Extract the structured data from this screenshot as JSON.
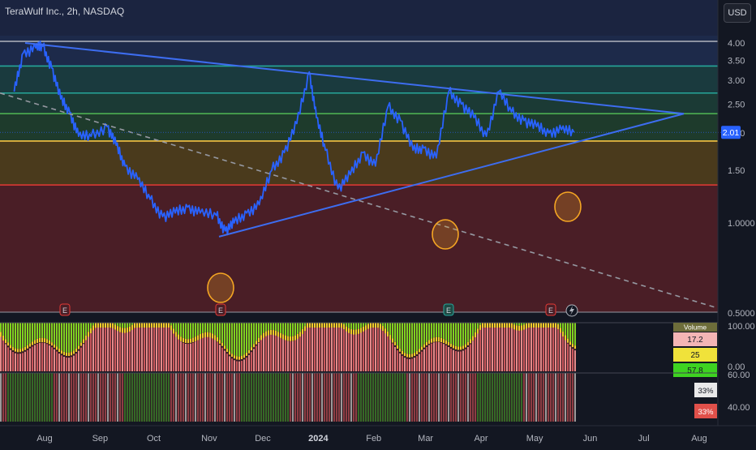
{
  "header": {
    "symbol_title": "TeraWulf Inc., 2h, NASDAQ",
    "currency_label": "USD"
  },
  "colors": {
    "background": "#131722",
    "price_line": "#2962ff",
    "trendline": "#3d6df0",
    "dashed_line": "#9598a1",
    "level_cyan": "#26a69a",
    "level_green": "#4caf50",
    "level_yellow": "#f6c343",
    "level_red": "#e53935",
    "highlight_circle": "#f5a623"
  },
  "chart_data": [
    {
      "type": "line",
      "panel": "price",
      "y_scale": "log",
      "ylim": [
        0.5,
        4.5
      ],
      "y_ticks": [
        "4.00",
        "3.50",
        "3.00",
        "2.50",
        "2.00",
        "1.50",
        "1.0000",
        "0.5000"
      ],
      "x_ticks": [
        "Aug",
        "Sep",
        "Oct",
        "Nov",
        "Dec",
        "2024",
        "Feb",
        "Mar",
        "Apr",
        "May",
        "Jun",
        "Jul",
        "Aug"
      ],
      "last_price_label": "2.01",
      "series": [
        {
          "x": [
            "Jul 15",
            "Jul 20",
            "Jul 27",
            "Jul 31",
            "Aug 5",
            "Aug 10",
            "Aug 15",
            "Aug 20",
            "Aug 27",
            "Sep 5",
            "Sep 10",
            "Sep 15",
            "Sep 22",
            "Sep 29",
            "Oct 6",
            "Oct 13",
            "Oct 20",
            "Oct 27",
            "Nov 5",
            "Nov 10",
            "Nov 15",
            "Nov 22",
            "Nov 29",
            "Dec 6",
            "Dec 13",
            "Dec 20",
            "Dec 27",
            "Dec 31",
            "Jan 5",
            "Jan 12",
            "Jan 19",
            "Jan 26",
            "Feb 2",
            "Feb 9",
            "Feb 16",
            "Feb 23",
            "Mar 1",
            "Mar 8",
            "Mar 15",
            "Mar 22",
            "Mar 29",
            "Apr 5",
            "Apr 12",
            "Apr 19",
            "Apr 26",
            "May 3",
            "May 10",
            "May 17",
            "May 24"
          ],
          "y": [
            2.75,
            3.7,
            3.85,
            3.9,
            3.3,
            2.6,
            2.35,
            1.95,
            1.95,
            2.1,
            1.82,
            1.55,
            1.4,
            1.2,
            1.05,
            1.08,
            1.13,
            1.08,
            1.06,
            0.94,
            1.0,
            1.08,
            1.15,
            1.5,
            1.72,
            2.15,
            3.2,
            2.25,
            1.75,
            1.3,
            1.45,
            1.72,
            1.55,
            2.45,
            2.2,
            1.75,
            1.78,
            1.65,
            2.75,
            2.5,
            2.25,
            1.95,
            2.75,
            2.35,
            2.2,
            2.1,
            2.0,
            2.05,
            2.01
          ]
        }
      ],
      "horizontal_levels": [
        4.05,
        3.35,
        2.72,
        2.32,
        1.88,
        1.34
      ],
      "triangle_upper": {
        "from": [
          "Jul 31",
          4.0
        ],
        "apex": [
          "Jul 25",
          2.32
        ]
      },
      "triangle_lower": {
        "from": [
          "Nov 10",
          0.9
        ],
        "apex": [
          "Jul 25",
          2.32
        ]
      },
      "dashed_trend": {
        "from": [
          "Jul 15",
          2.72
        ],
        "to": [
          "Aug 15",
          0.55
        ]
      },
      "earnings_markers": [
        "Aug 3",
        "Nov 13",
        "Mar 10",
        "May 8"
      ],
      "highlight_circles": [
        "Nov 13",
        "Mar 12",
        "May 22"
      ]
    },
    {
      "type": "area",
      "panel": "oscillator",
      "title": "",
      "ylim": [
        0,
        100
      ],
      "y_ticks": [
        "100.00",
        "0.00"
      ],
      "table": {
        "header": "Volume",
        "rows": [
          "17.2",
          "25",
          "57.8"
        ]
      }
    },
    {
      "type": "bar",
      "panel": "signals",
      "y_ticks": [
        "60.00",
        "40.00"
      ],
      "badges": [
        "33%",
        "33%"
      ]
    }
  ]
}
